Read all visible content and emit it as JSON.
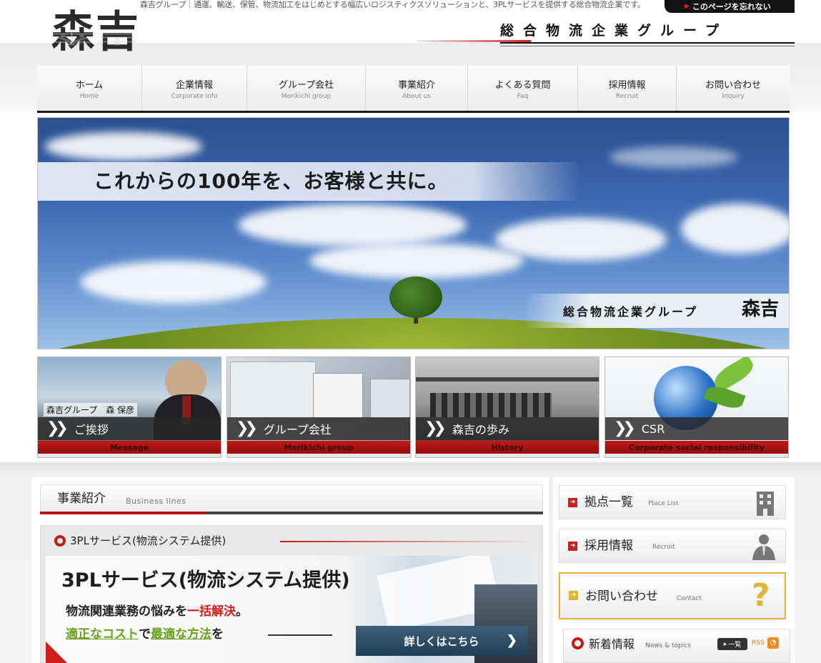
{
  "header": {
    "tagline": "森吉グループ｜通運、輸送、保管、物流加工をはじめとする幅広いロジスティクスソリューションと、3PLサービスを提供する総合物流企業です。",
    "bookmark_label": "このページを忘れない",
    "logo_text": "森吉",
    "slogan": "総合物流企業グループ"
  },
  "nav": {
    "items": [
      {
        "jp": "ホーム",
        "en": "Home"
      },
      {
        "jp": "企業情報",
        "en": "Corporate info"
      },
      {
        "jp": "グループ会社",
        "en": "Morikichi group"
      },
      {
        "jp": "事業紹介",
        "en": "About us"
      },
      {
        "jp": "よくある質問",
        "en": "Faq"
      },
      {
        "jp": "採用情報",
        "en": "Recruit"
      },
      {
        "jp": "お問い合わせ",
        "en": "Inquiry"
      }
    ]
  },
  "hero": {
    "catch": "これからの100年を、お客様と共に。",
    "group_label": "総合物流企業グループ",
    "group_name": "森吉"
  },
  "banners": [
    {
      "caption": "森吉グループ　森 保彦",
      "jp": "ご挨拶",
      "en": "Message"
    },
    {
      "jp": "グループ会社",
      "en": "Morikichi group"
    },
    {
      "jp": "森吉の歩み",
      "en": "History"
    },
    {
      "jp": "CSR",
      "en": "Corporate social responsibility"
    }
  ],
  "main": {
    "section_title": "事業紹介",
    "section_sub": "Business lines",
    "service_label": "3PLサービス(物流システム提供)",
    "service_title": "3PLサービス(物流システム提供)",
    "line2_a": "物流関連業務の悩みを",
    "line2_em": "一括解決",
    "line2_b": "。",
    "line3_a": "適正なコスト",
    "line3_b": "で",
    "line3_c": "最適な方法",
    "line3_d": "を",
    "detail_button": "詳しくはこちら"
  },
  "side": {
    "places": {
      "jp": "拠点一覧",
      "en": "Place List"
    },
    "recruit": {
      "jp": "採用情報",
      "en": "Recruit"
    },
    "contact": {
      "jp": "お問い合わせ",
      "en": "Contact"
    },
    "news": {
      "jp": "新着情報",
      "en": "News & topics",
      "list_label": "一覧",
      "rss_label": "RSS"
    }
  },
  "colors": {
    "accent_red": "#c41818",
    "nav_dark": "#1a1a1a",
    "contact_gold": "#e0b43a",
    "button_blue": "#2b4b63"
  }
}
